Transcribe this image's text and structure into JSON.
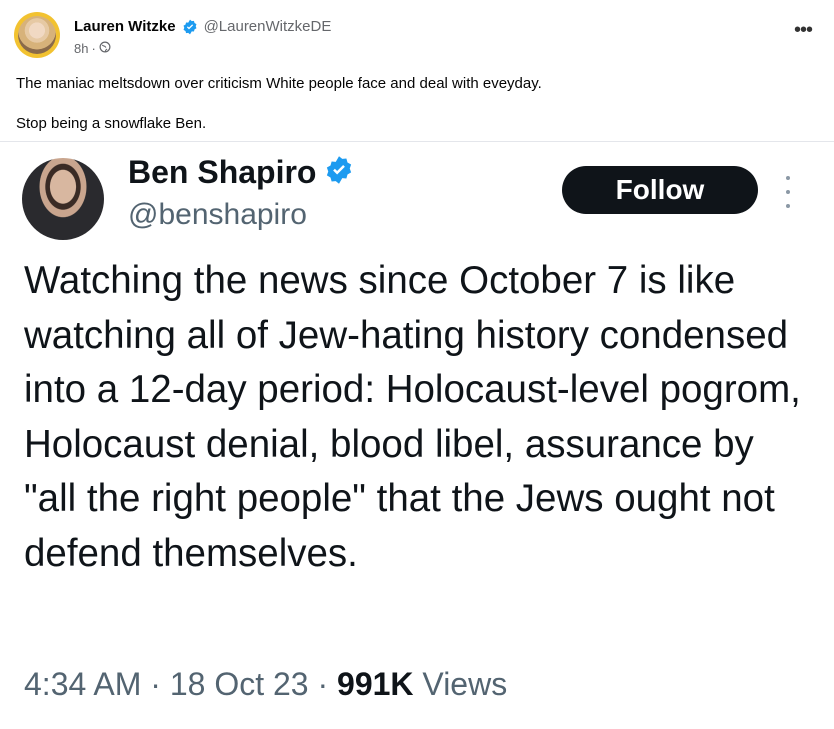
{
  "post": {
    "author": "Lauren Witzke",
    "handle": "@LaurenWitzkeDE",
    "time": "8h",
    "separator": "·",
    "icons": {
      "verified": "verified-badge-icon",
      "audience": "globe-icon",
      "more": "more-dots-icon"
    },
    "caption_line1": "The maniac meltsdown over criticism White people face and deal with eveyday.",
    "caption_line2": "Stop being a snowflake Ben."
  },
  "embed": {
    "name": "Ben Shapiro",
    "handle": "@benshapiro",
    "follow_label": "Follow",
    "text": "Watching the news since October 7 is like watching all of Jew-hating history condensed into a 12-day period: Holocaust-level pogrom, Holocaust denial, blood libel, assurance by \"all the right people\" that the Jews ought not defend themselves.",
    "time": "4:34 AM",
    "date": "18 Oct 23",
    "dot": " · ",
    "views_count": "991K",
    "views_label": "Views"
  },
  "colors": {
    "verified": "#1d9bf0",
    "follow_bg": "#0f1419",
    "muted": "#536471",
    "avatar_ring": "#f2c230"
  }
}
